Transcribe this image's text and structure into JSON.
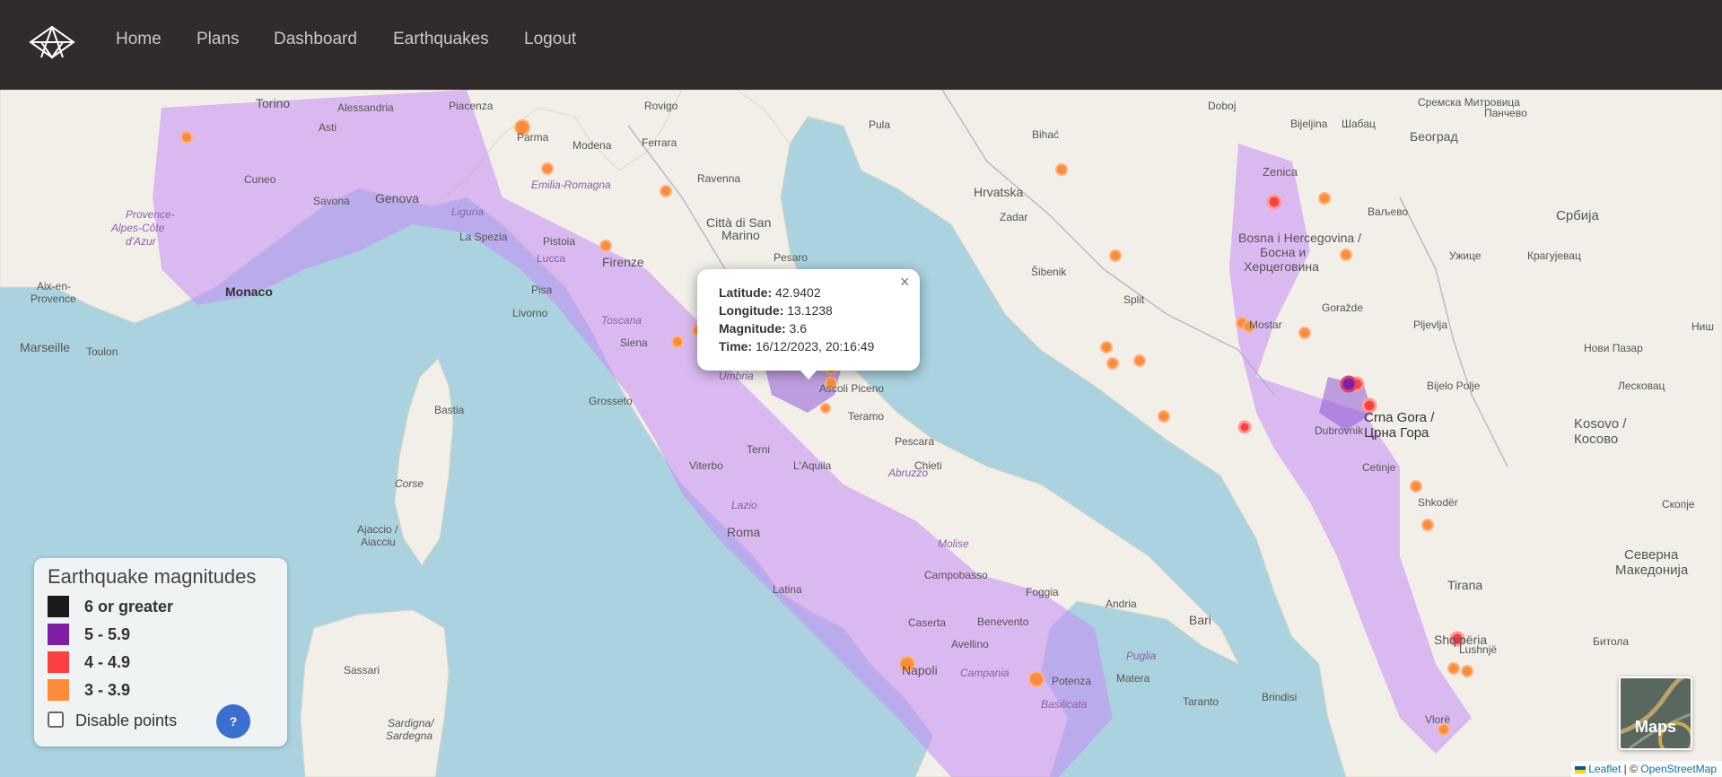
{
  "navbar": {
    "links": [
      "Home",
      "Plans",
      "Dashboard",
      "Earthquakes",
      "Logout"
    ]
  },
  "map": {
    "labels": [
      "Torino",
      "Alessandria",
      "Piacenza",
      "Rovigo",
      "Pula",
      "Bihać",
      "Doboj",
      "Bijeljina",
      "Шабац",
      "Београд",
      "Сремска Митровица",
      "Панчево",
      "Parma",
      "Modena",
      "Ferrara",
      "Cuneo",
      "Asti",
      "Savona",
      "Genova",
      "Emilia-Romagna",
      "Ravenna",
      "Хрватска",
      "Hrvatska",
      "Zadar",
      "Zenica",
      "Ваљево",
      "Србија",
      "Liguria",
      "La Spezia",
      "Pistoia",
      "Città di San Marino",
      "Pesaro",
      "Lucca",
      "Firenze",
      "Šibenik",
      "Bosna i Hercegovina / Босна и Херцеговина",
      "Ужице",
      "Крагујевац",
      "Provence-Alpes-Côte d'Azur",
      "Aix-en-Provence",
      "Monaco",
      "Pisa",
      "Livorno",
      "Toscana",
      "Split",
      "Goražde",
      "Siena",
      "Mostar",
      "Pljevlja",
      "Ниш",
      "Marseille",
      "Toulon",
      "Нови Пазар",
      "Umbria",
      "Ascoli Piceno",
      "Bastia",
      "Grosseto",
      "Teramo",
      "Bijelo Polje",
      "Лесковац",
      "Dubrovnik",
      "Crna Gora / Црна Гора",
      "Kosovo / Косово",
      "Pescara",
      "Terni",
      "L'Aquila",
      "Abruzzo",
      "Chieti",
      "Corse",
      "Viterbo",
      "Cetinje",
      "Shkodër",
      "Lazio",
      "Ajaccio / Aiacciu",
      "Roma",
      "Molise",
      "Campobasso",
      "Foggia",
      "Andria",
      "Bari",
      "Tirana",
      "Latina",
      "Caserta",
      "Benevento",
      "Avellino",
      "Napoli",
      "Campania",
      "Puglia",
      "Matera",
      "Potenza",
      "Basilicata",
      "Taranto",
      "Brindisi",
      "Shqipëria",
      "Lushnjë",
      "Sassari",
      "Sardigna / Sardegna",
      "Vlorë",
      "Северна Македонија",
      "Скопје",
      "Битола"
    ]
  },
  "popup": {
    "rows": [
      {
        "label": "Latitude:",
        "value": "42.9402"
      },
      {
        "label": "Longitude:",
        "value": "13.1238"
      },
      {
        "label": "Magnitude:",
        "value": "3.6"
      },
      {
        "label": "Time:",
        "value": "16/12/2023, 20:16:49"
      }
    ],
    "close": "×"
  },
  "legend": {
    "title": "Earthquake magnitudes",
    "items": [
      {
        "label": "6 or greater",
        "color": "#1a1a1a"
      },
      {
        "label": "5 - 5.9",
        "color": "#7e1fa6"
      },
      {
        "label": "4 - 4.9",
        "color": "#ff4040"
      },
      {
        "label": "3 - 3.9",
        "color": "#ff8c3a"
      }
    ],
    "checkbox_label": "Disable points",
    "help_label": "?"
  },
  "layer_button": {
    "label": "Maps"
  },
  "attribution": {
    "leaflet": "Leaflet",
    "separator": "|",
    "copyright": "©",
    "osm": "OpenStreetMap"
  },
  "colors": {
    "navbar": "#312b2b",
    "sea": "#aad3df",
    "land": "#f2efe9",
    "hex": "#c78cf5",
    "mag3": "#ff8c3a",
    "mag4": "#ff4040",
    "mag5": "#7e1fa6"
  }
}
